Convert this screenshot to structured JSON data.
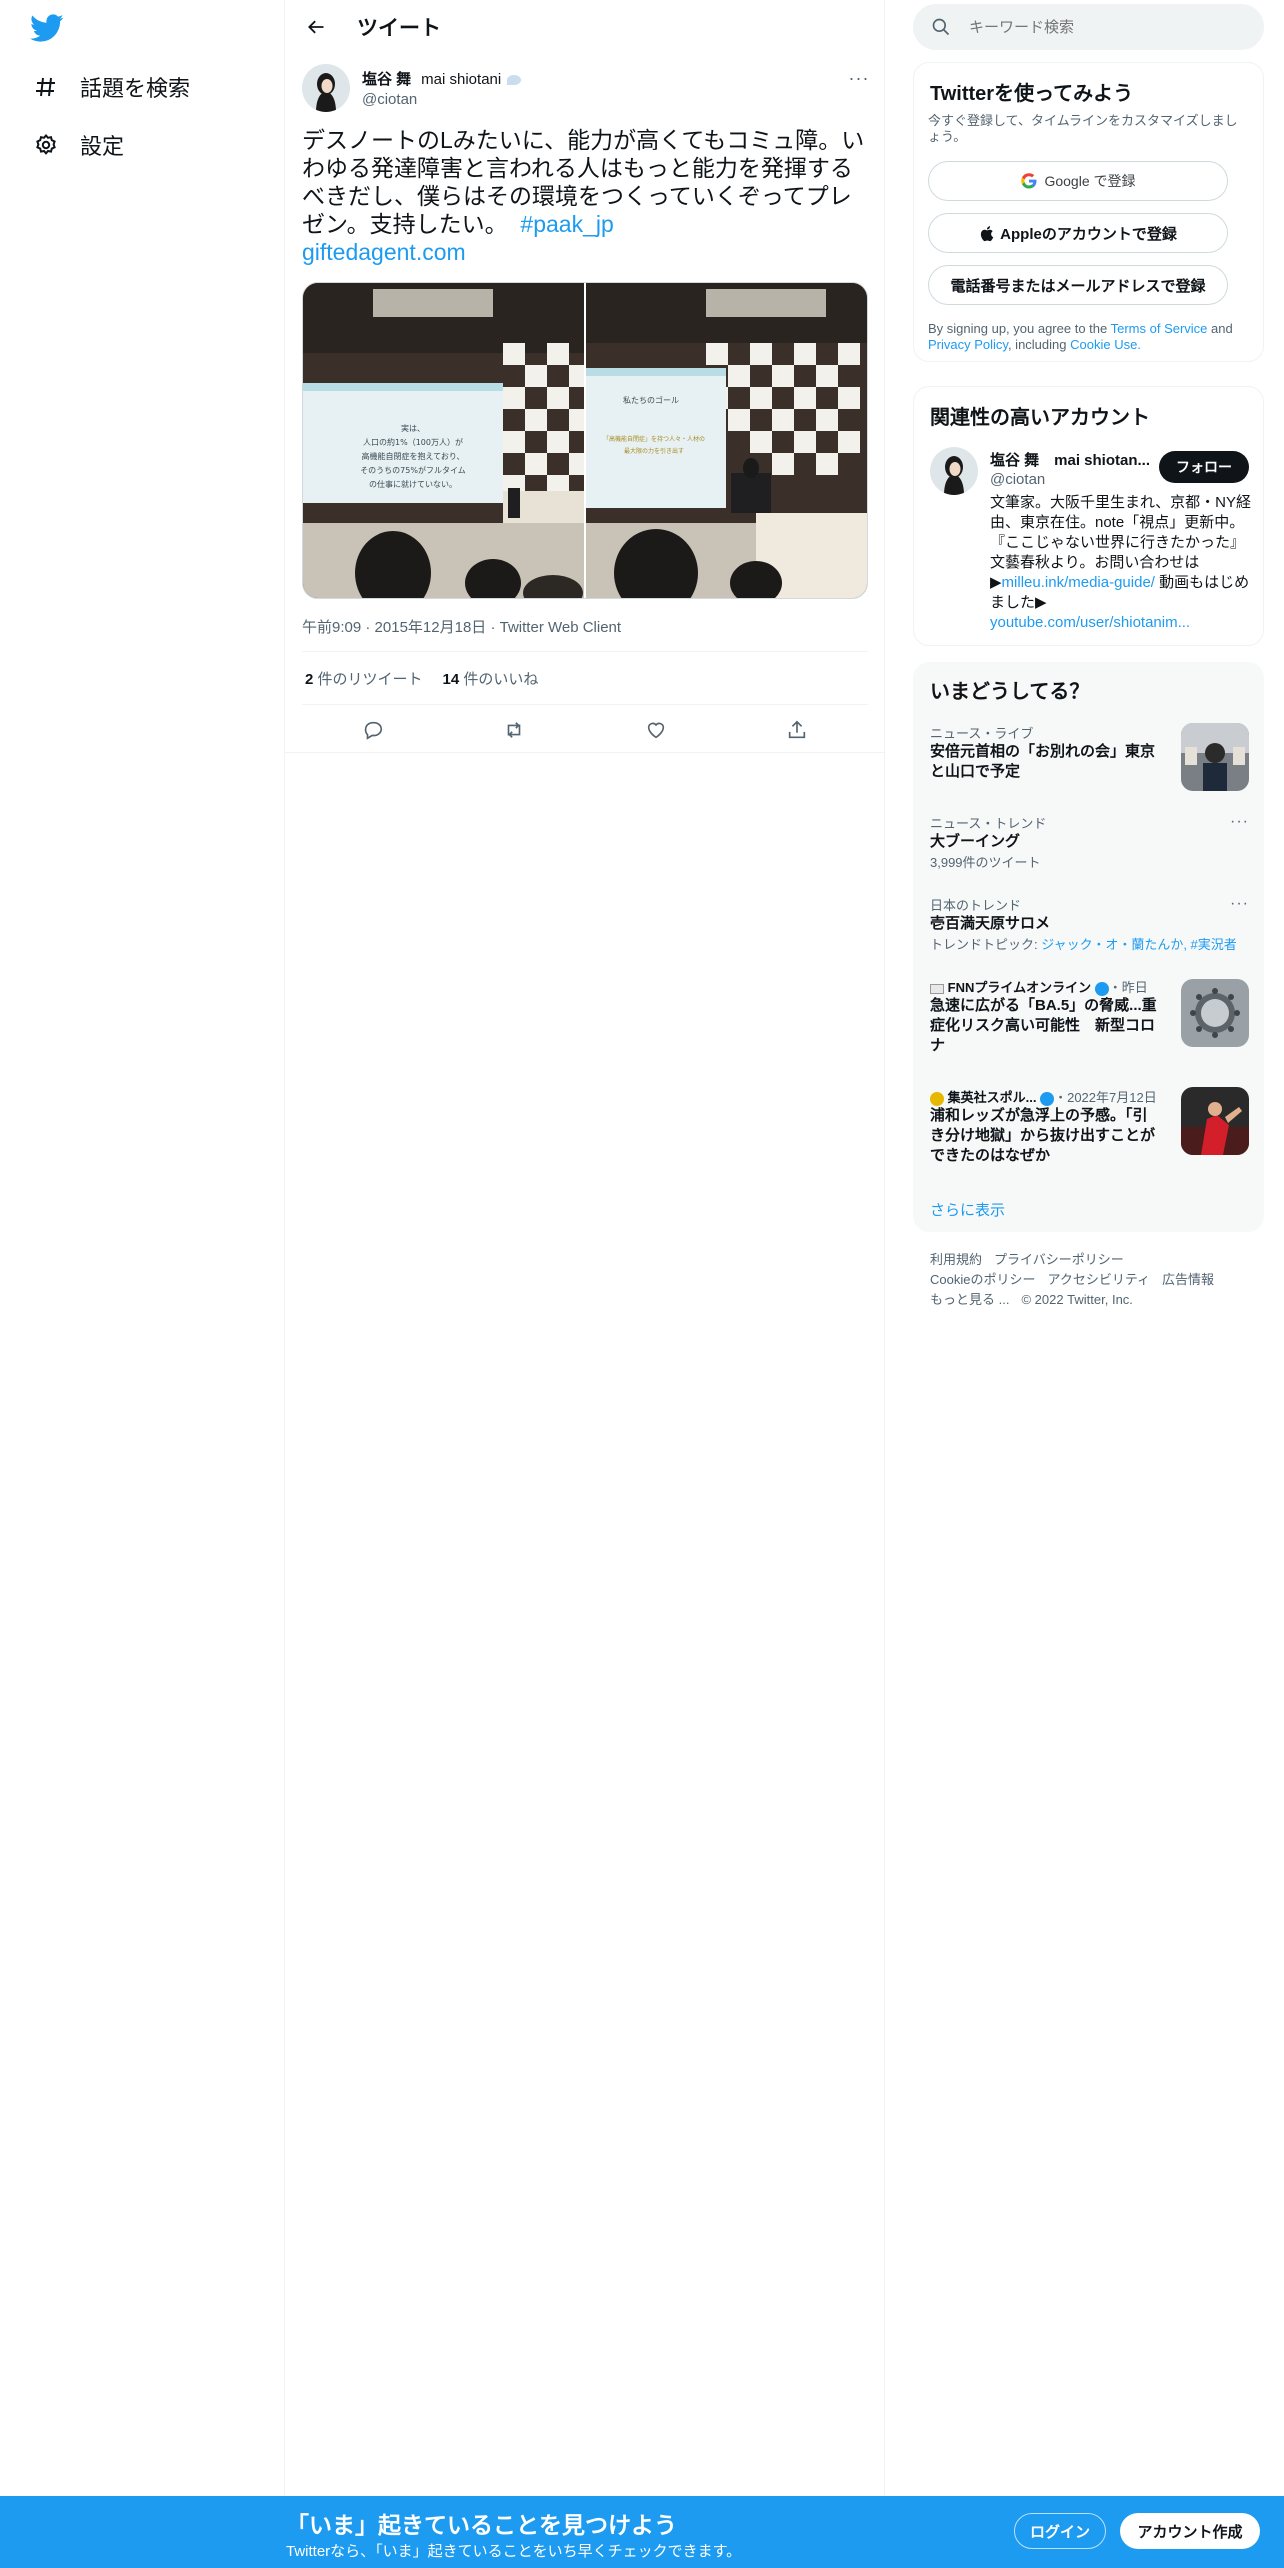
{
  "nav": {
    "logo": "twitter-bird-icon",
    "items": [
      {
        "icon": "hashtag-icon",
        "label": "話題を検索"
      },
      {
        "icon": "gear-icon",
        "label": "設定"
      }
    ]
  },
  "header": {
    "title": "ツイート"
  },
  "tweet": {
    "author_name": "塩谷 舞",
    "author_name_en": "mai shiotani",
    "handle": "@ciotan",
    "text": "デスノートのLみたいに、能力が高くてもコミュ障。いわゆる発達障害と言われる人はもっと能力を発揮するべきだし、僕らはその環境をつくっていくぞってプレゼン。支持したい。",
    "hashtag": "#paak_jp",
    "link": "giftedagent.com",
    "slide1_lines": [
      "実は、",
      "人口の約1%（100万人）が",
      "高機能自閉症を抱えており、",
      "そのうちの75%がフルタイム",
      "の仕事に就けていない。"
    ],
    "slide2_lines": [
      "私たちのゴール",
      "「高機能自閉症」を持つ人々・人材の",
      "最大限の力を引き出す"
    ],
    "time": "午前9:09",
    "date": "2015年12月18日",
    "client": "Twitter Web Client",
    "retweets": "2",
    "retweets_label": "件のリツイート",
    "likes": "14",
    "likes_label": "件のいいね"
  },
  "search": {
    "placeholder": "キーワード検索"
  },
  "signup": {
    "title": "Twitterを使ってみよう",
    "desc": "今すぐ登録して、タイムラインをカスタマイズしましょう。",
    "google": "Google で登録",
    "apple": "Appleのアカウントで登録",
    "phone": "電話番号またはメールアドレスで登録",
    "terms_prefix": "By signing up, you agree to the ",
    "terms": "Terms of Service",
    "and": " and ",
    "privacy": "Privacy Policy",
    "including": ", including ",
    "cookie": "Cookie Use."
  },
  "relevant": {
    "title": "関連性の高いアカウント",
    "name": "塩谷 舞　mai shiotan...",
    "handle": "@ciotan",
    "follow": "フォロー",
    "bio": "文筆家。大阪千里生まれ、京都・NY経由、東京在住。note「視点」更新中。『ここじゃない世界に行きたかった』文藝春秋より。お問い合わせは▶",
    "bio_link1": "milleu.ink/media-guide/",
    "bio_mid": " 動画もはじめました▶",
    "bio_link2": "youtube.com/user/shiotanim..."
  },
  "trends": {
    "title": "いまどうしてる？",
    "items": [
      {
        "category": "ニュース・ライブ",
        "title": "安倍元首相の「お別れの会」東京と山口で予定"
      },
      {
        "category": "ニュース・トレンド",
        "title": "大ブーイング",
        "count": "3,999件のツイート"
      },
      {
        "category": "日本のトレンド",
        "title": "壱百満天原サロメ",
        "topic_label": "トレンドトピック: ",
        "topics": "ジャック・オ・蘭たんか, #実況者"
      },
      {
        "source": "FNNプライムオンライン",
        "time": "・昨日",
        "title": "急速に広がる「BA.5」の脅威...重症化リスク高い可能性　新型コロナ"
      },
      {
        "source": "集英社スポル...",
        "time": "・2022年7月12日",
        "title": "浦和レッズが急浮上の予感。「引き分け地獄」から抜け出すことができたのはなぜか"
      }
    ],
    "show_more": "さらに表示"
  },
  "footer": {
    "links": [
      "利用規約",
      "プライバシーポリシー",
      "Cookieのポリシー",
      "アクセシビリティ",
      "広告情報",
      "もっと見る ..."
    ],
    "copyright": "© 2022 Twitter, Inc."
  },
  "banner": {
    "title": "「いま」起きていることを見つけよう",
    "sub": "Twitterなら、「いま」起きていることをいち早くチェックできます。",
    "login": "ログイン",
    "signup": "アカウント作成"
  },
  "colors": {
    "accent": "#1d9bf0",
    "text": "#0f1419",
    "muted": "#536471",
    "banner": "#1d9bf0"
  }
}
